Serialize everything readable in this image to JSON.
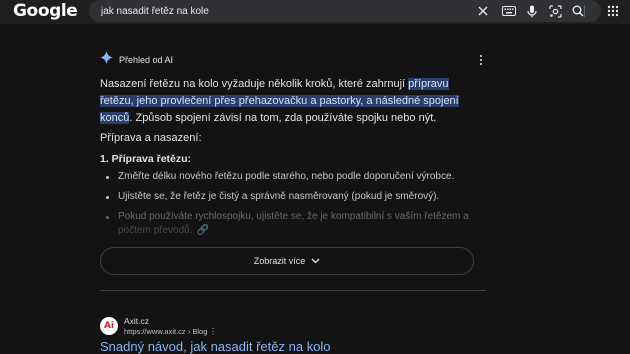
{
  "header": {
    "logo_text": "Google",
    "search_value": "jak nasadit řetěz na kole",
    "icons": [
      "close-icon",
      "keyboard-icon",
      "mic-icon",
      "lens-icon",
      "search-icon",
      "apps-icon"
    ]
  },
  "ai_overview": {
    "title": "Přehled od AI",
    "intro_before": "Nasazení řetězu na kolo vyžaduje několik kroků, které zahrnují ",
    "intro_highlight": "přípravu řetězu, jeho provlečení přes přehazovačku a pastorky, a následné spojení konců",
    "intro_after": ". Způsob spojení závisí na tom, zda používáte spojku nebo nýt.",
    "section_heading": "Příprava a nasazení:",
    "step_heading": "1. Příprava řetězu:",
    "bullets": [
      "Změřte délku nového řetězu podle starého, nebo podle doporučení výrobce.",
      "Ujistěte se, že řetěz je čistý a správně nasměrovaný (pokud je směrový).",
      "Pokud používáte rychlospojku, ujistěte se, že je kompatibilní s vaším řetězem a počtem převodů."
    ],
    "show_more_label": "Zobrazit více"
  },
  "result": {
    "site_icon_text": "Ai",
    "site_name": "Axit.cz",
    "site_url": "https://www.axit.cz › Blog",
    "title": "Snadný návod, jak nasadit řetěz na kolo"
  },
  "colors": {
    "background": "#131313",
    "topbar": "#1f1f1f",
    "highlight": "#2c3e6b",
    "link": "#8ab4f8",
    "ai_sparkle": "#8ab4f8"
  }
}
